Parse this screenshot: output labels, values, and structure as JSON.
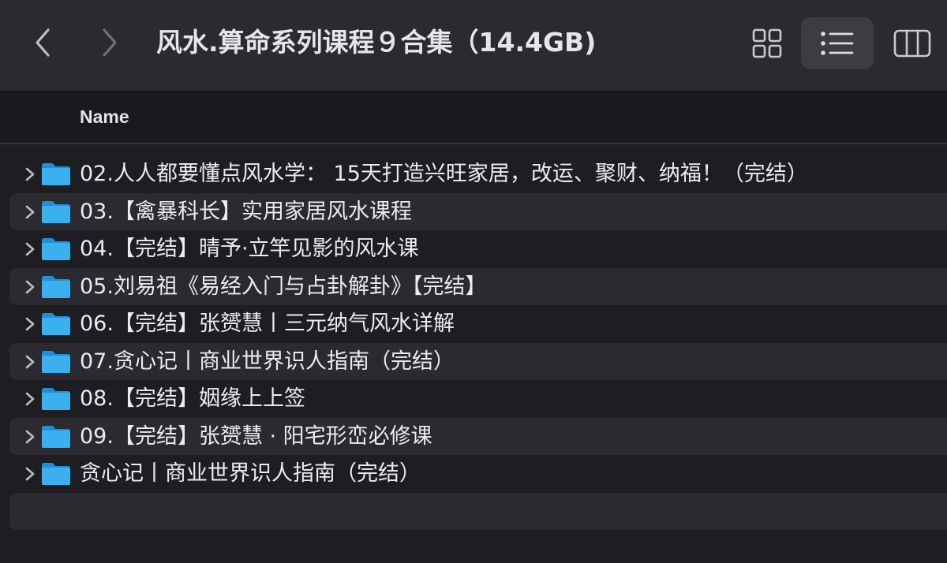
{
  "window": {
    "title": "风水.算命系列课程９合集（14.4GB)"
  },
  "toolbar": {
    "back_icon": "chevron-left-icon",
    "forward_icon": "chevron-right-icon",
    "view_buttons": [
      {
        "icon": "grid-view-icon",
        "active": false
      },
      {
        "icon": "list-view-icon",
        "active": true
      },
      {
        "icon": "column-view-icon",
        "active": false
      }
    ]
  },
  "columns": {
    "name_header": "Name"
  },
  "folders": [
    {
      "name": "02.人人都要懂点风水学： 15天打造兴旺家居，改运、聚财、纳福！（完结）"
    },
    {
      "name": "03.【禽暴科长】实用家居风水课程"
    },
    {
      "name": "04.【完结】晴予·立竿见影的风水课"
    },
    {
      "name": "05.刘易祖《易经入门与占卦解卦》【完结】"
    },
    {
      "name": "06.【完结】张赟慧丨三元纳气风水详解"
    },
    {
      "name": "07.贪心记丨商业世界识人指南（完结）"
    },
    {
      "name": "08.【完结】姻缘上上签"
    },
    {
      "name": "09.【完结】张赟慧 · 阳宅形峦必修课"
    },
    {
      "name": "贪心记丨商业世界识人指南（完结）"
    }
  ],
  "colors": {
    "toolbar_bg": "#2b2a30",
    "window_bg": "#1e1e22",
    "header_bg": "#1a191e",
    "alt_row_bg": "#2b2a30",
    "folder_blue": "#3ab0f0",
    "folder_tab_blue": "#1f8fd9",
    "text": "#ececef"
  }
}
